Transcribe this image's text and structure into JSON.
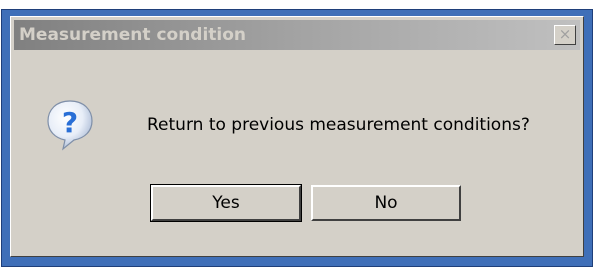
{
  "dialog": {
    "title": "Measurement condition",
    "close_label": "×",
    "message": "Return to previous measurement conditions?",
    "icon": "question-icon",
    "buttons": {
      "yes": "Yes",
      "no": "No"
    }
  },
  "colors": {
    "window_border": "#3f6fb8",
    "face": "#d4d0c8",
    "icon_blue": "#2a6fd6"
  }
}
